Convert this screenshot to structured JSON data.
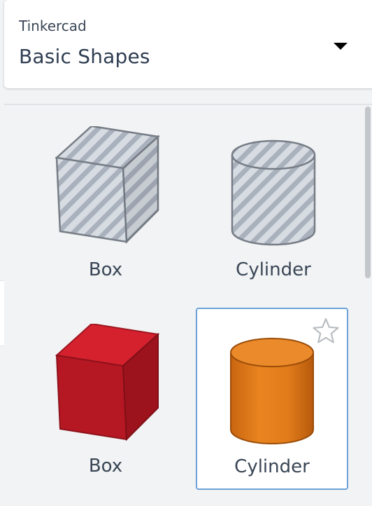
{
  "header": {
    "brand": "Tinkercad",
    "category": "Basic Shapes",
    "dropdown_icon": "caret-down-icon"
  },
  "shapes": [
    {
      "name": "Box",
      "style": "hole",
      "selected": false
    },
    {
      "name": "Cylinder",
      "style": "hole",
      "selected": false
    },
    {
      "name": "Box",
      "style": "solid",
      "color": "#c81a25",
      "selected": false
    },
    {
      "name": "Cylinder",
      "style": "solid",
      "color": "#e07b1a",
      "selected": true,
      "favorite_icon": "star-outline-icon"
    }
  ],
  "colors": {
    "selection_border": "#6ea2d9",
    "hole_fill": "#c9ced6",
    "box_red": "#c81a25",
    "cylinder_orange": "#e07b1a"
  }
}
